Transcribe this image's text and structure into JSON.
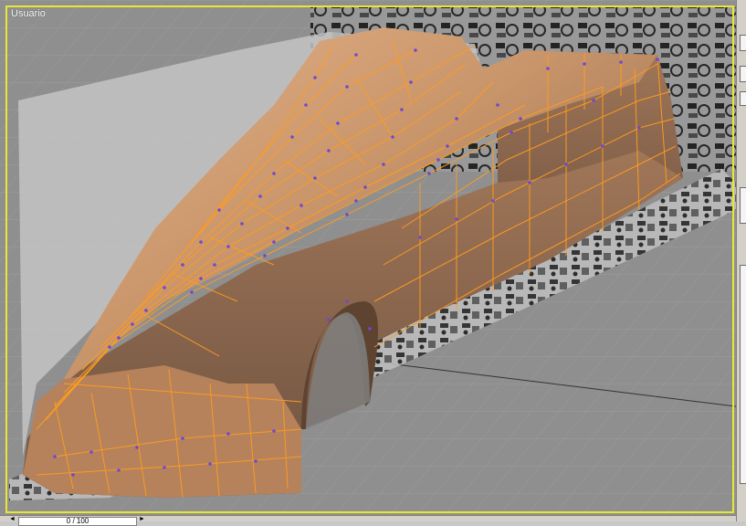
{
  "viewport": {
    "label": "Usuario"
  },
  "status": {
    "frame_field": "0 / 100"
  },
  "colors": {
    "frame_highlight": "#e8e833",
    "mesh_wire": "#ff9c1e",
    "vertex": "#6a4ad6",
    "body_fill": "#c89468",
    "grid_bg": "#8f8f8f"
  },
  "icons": [
    "left-arrow-icon",
    "right-arrow-icon"
  ]
}
